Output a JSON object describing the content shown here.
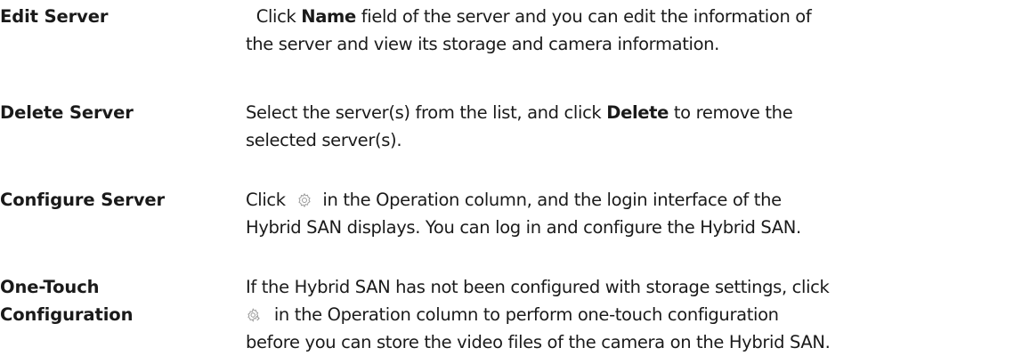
{
  "rows": [
    {
      "term": "Edit Server",
      "lines": [
        {
          "pre": "  Click ",
          "bold": "Name",
          "post": " field of the server and you can edit the information of"
        },
        {
          "text": "the server and view its storage and camera information."
        }
      ]
    },
    {
      "term": "Delete Server",
      "lines": [
        {
          "pre": "Select the server(s) from the list, and click ",
          "bold": "Delete",
          "post": " to remove the"
        },
        {
          "text": "selected server(s)."
        }
      ]
    },
    {
      "term": "Configure Server",
      "lines": [
        {
          "pre": "Click ",
          "icon": "gear-icon",
          "post": " in the Operation column, and the login interface of the"
        },
        {
          "text": "Hybrid SAN displays. You can log in and configure the Hybrid SAN."
        }
      ]
    },
    {
      "term_line1": "One-Touch",
      "term_line2": "Configuration",
      "lines": [
        {
          "text": "If the Hybrid SAN has not been configured with storage settings, click"
        },
        {
          "icon": "one-touch-config-icon",
          "post": " in the Operation column to perform one-touch configuration"
        },
        {
          "text": "before you can store the video files of the camera on the Hybrid SAN."
        }
      ]
    }
  ],
  "colors": {
    "text": "#1a1a1a",
    "icon": "#9a9a9a"
  }
}
